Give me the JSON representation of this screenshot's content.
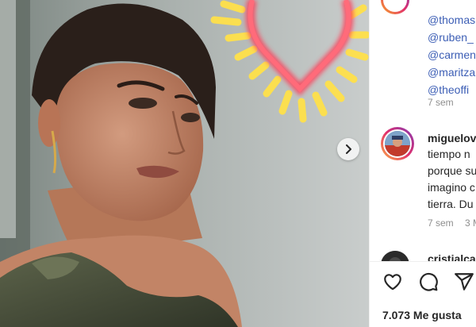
{
  "post": {
    "next_label": "›"
  },
  "comments_panel": {
    "mentions": [
      "@thomas",
      "@ruben_",
      "@carmen",
      "@maritza",
      "@theoffi"
    ],
    "mentions_time": "7 sem",
    "comment": {
      "username": "miguelov",
      "lines": [
        "tiempo n",
        "porque su",
        "imagino c",
        "tierra. Du"
      ],
      "time": "7 sem",
      "likes_fragment": "3 M"
    },
    "next_username": "cristialcai"
  },
  "actions": {
    "like_icon": "heart-icon",
    "comment_icon": "comment-icon",
    "share_icon": "share-icon"
  },
  "likes_text": "7.073 Me gusta"
}
